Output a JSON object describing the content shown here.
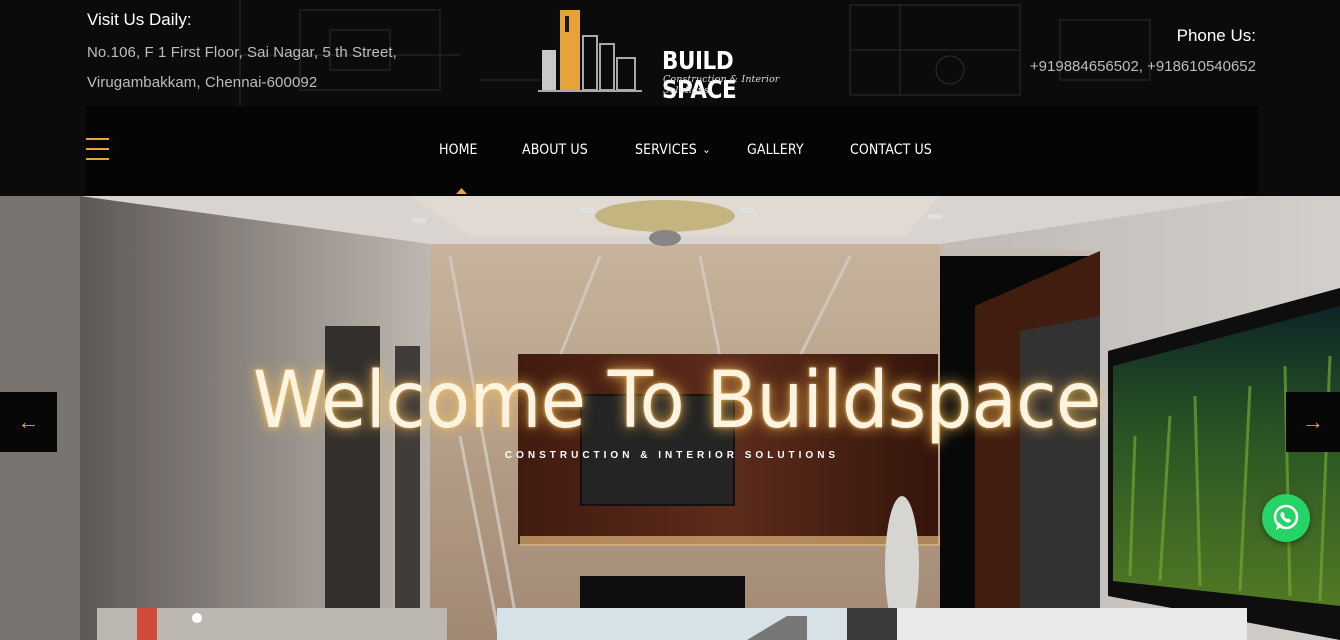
{
  "header": {
    "visit_heading": "Visit Us Daily:",
    "address_line1": "No.106, F 1 First Floor, Sai Nagar, 5 th Street,",
    "address_line2": "Virugambakkam, Chennai-600092",
    "phone_heading": "Phone Us:",
    "phone_numbers": "+919884656502, +918610540652"
  },
  "logo": {
    "brand": "BUILD SPACE",
    "tagline": "Construction & Interior Solutions"
  },
  "nav": {
    "items": [
      {
        "label": "HOME",
        "active": true
      },
      {
        "label": "ABOUT US"
      },
      {
        "label": "SERVICES",
        "has_dropdown": true
      },
      {
        "label": "GALLERY"
      },
      {
        "label": "CONTACT US"
      }
    ],
    "menu_icon": "hamburger-icon"
  },
  "hero": {
    "title": "Welcome To Buildspace",
    "subtitle": "CONSTRUCTION & INTERIOR SOLUTIONS",
    "prev_icon": "arrow-left-icon",
    "next_icon": "arrow-right-icon"
  },
  "colors": {
    "accent": "#e8a23a",
    "background": "#0b0b0b",
    "whatsapp": "#25d366"
  }
}
